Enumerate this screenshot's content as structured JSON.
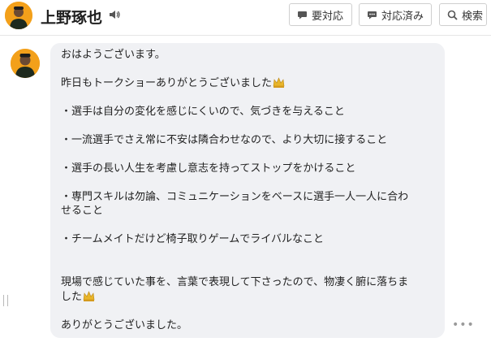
{
  "header": {
    "name": "上野琢也",
    "buttons": {
      "needs_response": "要対応",
      "responded": "対応済み",
      "search": "検索"
    }
  },
  "message": {
    "lines": [
      "おはようございます。",
      "昨日もトークショーありがとうございました",
      "・選手は自分の変化を感じにくいので、気づきを与えること",
      "・一流選手でさえ常に不安は隣合わせなので、より大切に接すること",
      "・選手の長い人生を考慮し意志を持ってストップをかけること",
      "・専門スキルは勿論、コミュニケーションをベースに選手一人一人に合わ",
      "せること",
      "・チームメイトだけど椅子取りゲームでライバルなこと",
      "現場で感じていた事を、言葉で表現して下さったので、物凄く腑に落ちま",
      "した",
      "ありがとうございました。"
    ]
  },
  "colors": {
    "bubble": "#f0f1f4",
    "avatar_bg": "#f3a01a",
    "border": "#cfcfcf"
  },
  "icons": [
    "speaker-icon",
    "chat-bubble-icon",
    "search-icon",
    "crown-emoji-icon",
    "more-icon"
  ]
}
